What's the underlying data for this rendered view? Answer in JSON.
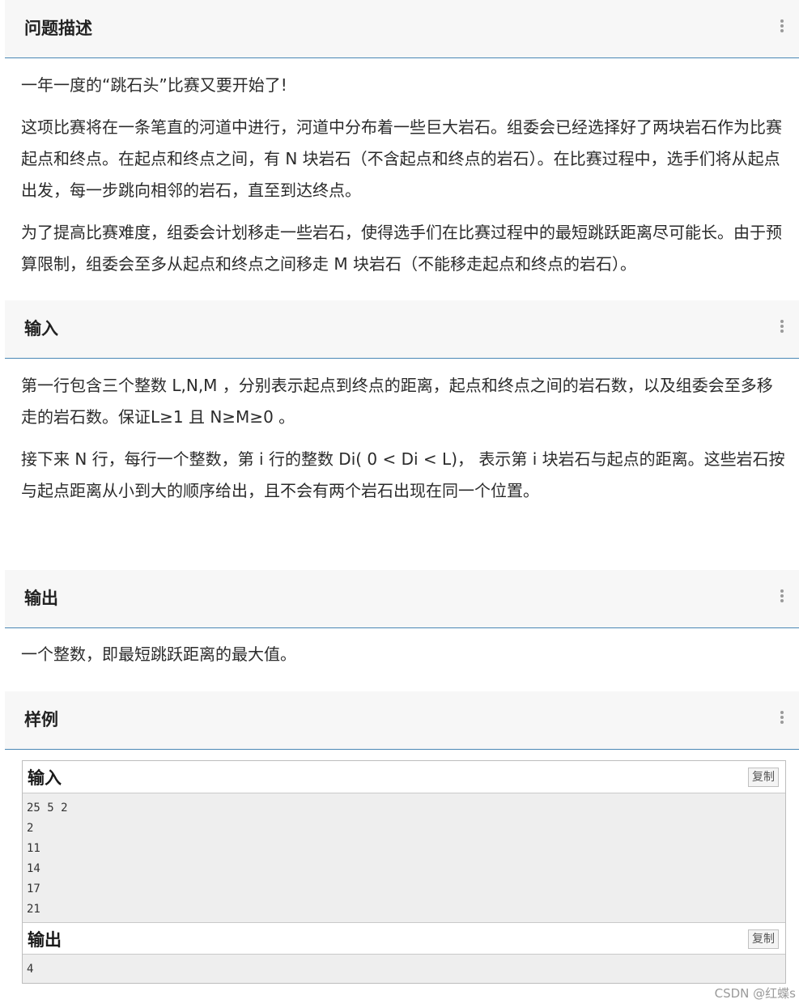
{
  "sections": {
    "description": {
      "title": "问题描述"
    },
    "input": {
      "title": "输入"
    },
    "output": {
      "title": "输出"
    },
    "sample": {
      "title": "样例"
    }
  },
  "description": {
    "p1": "一年一度的“跳石头”比赛又要开始了!",
    "p2": "这项比赛将在一条笔直的河道中进行，河道中分布着一些巨大岩石。组委会已经选择好了两块岩石作为比赛起点和终点。在起点和终点之间，有 N 块岩石（不含起点和终点的岩石）。在比赛过程中，选手们将从起点出发，每一步跳向相邻的岩石，直至到达终点。",
    "p3": "为了提高比赛难度，组委会计划移走一些岩石，使得选手们在比赛过程中的最短跳跃距离尽可能长。由于预算限制，组委会至多从起点和终点之间移走 M 块岩石（不能移走起点和终点的岩石）。"
  },
  "input_desc": {
    "p1": "第一行包含三个整数 L,N,M ，分别表示起点到终点的距离，起点和终点之间的岩石数，以及组委会至多移走的岩石数。保证L≥1 且 N≥M≥0 。",
    "p2": "接下来 N 行，每行一个整数，第 i 行的整数 Di( 0 < Di < L)， 表示第 i 块岩石与起点的距离。这些岩石按与起点距离从小到大的顺序给出，且不会有两个岩石出现在同一个位置。"
  },
  "output_desc": {
    "p1": "一个整数，即最短跳跃距离的最大值。"
  },
  "sample": {
    "input_label": "输入",
    "output_label": "输出",
    "copy_label": "复制",
    "input_lines": [
      "25 5 2",
      "2",
      "11",
      "14",
      "17",
      "21"
    ],
    "output_lines": [
      "4"
    ]
  },
  "watermark": "CSDN @红蝶s"
}
